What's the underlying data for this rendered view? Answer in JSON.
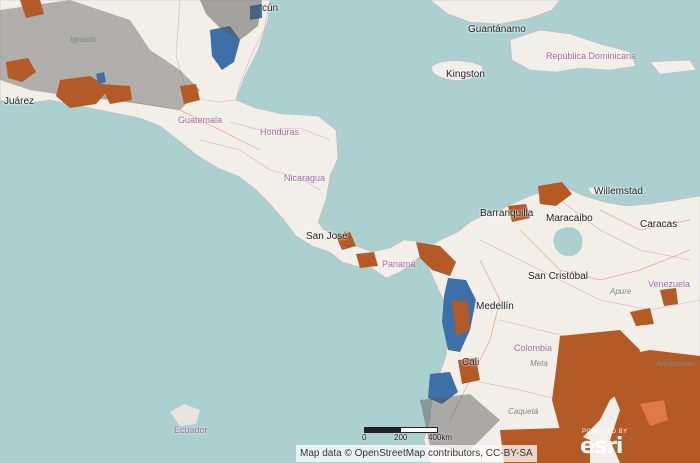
{
  "map": {
    "labels": {
      "cancun": "cún",
      "guantanamo": "Guantánamo",
      "republica_dominicana": "República Dominicana",
      "kingston": "Kingston",
      "juarez": "Juárez",
      "ignacio": "Ignacio",
      "guatemala": "Guatemala",
      "honduras": "Honduras",
      "nicaragua": "Nicaragua",
      "san_jose": "San José",
      "panama": "Panamá",
      "barranquilla": "Barranquilla",
      "maracaibo": "Maracaibo",
      "willemstad": "Willemstad",
      "caracas": "Caracas",
      "san_cristobal": "San Cristóbal",
      "apure": "Apure",
      "venezuela": "Venezuela",
      "medellin": "Medellín",
      "colombia": "Colombia",
      "meta": "Meta",
      "cali": "Cali",
      "amazonas": "Amazonas",
      "caqueta": "Caquetá",
      "ecuador": "Ecuador"
    },
    "scale": {
      "zero": "0",
      "mid": "200",
      "end": "400km"
    },
    "attribution": "Map data © OpenStreetMap contributors, CC-BY-SA",
    "logo": {
      "powered_by": "POWERED BY",
      "name": "esri"
    },
    "colors": {
      "water": "#acd0d0",
      "land": "#f2efe9",
      "choropleth_high": "#b35a26",
      "choropleth_low": "#3d6fa8"
    }
  }
}
